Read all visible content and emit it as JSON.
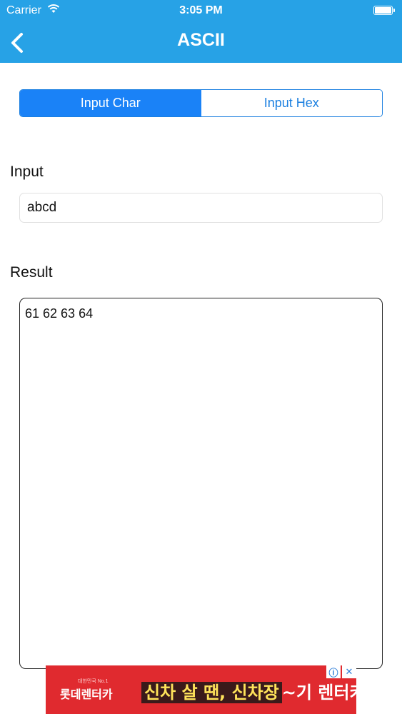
{
  "status_bar": {
    "carrier": "Carrier",
    "time": "3:05 PM",
    "wifi_icon": "wifi-icon",
    "battery_icon": "battery-icon"
  },
  "nav": {
    "title": "ASCII",
    "back_icon": "chevron-left-icon",
    "background": "#27a2e6"
  },
  "segmented": {
    "options": [
      "Input Char",
      "Input Hex"
    ],
    "selected": "Input Char",
    "accent": "#1a82f7"
  },
  "input": {
    "label": "Input",
    "value": "abcd"
  },
  "result": {
    "label": "Result",
    "value": "61 62 63 64"
  },
  "ad": {
    "brand_small": "대한민국 No.1",
    "brand": "롯데렌터카",
    "tagline_highlight": "신차 살 땐, 신차장",
    "tagline_rest": "~기 렌터카!!",
    "info_icon": "info-icon",
    "close_icon": "close-icon",
    "background": "#e02a2f"
  }
}
